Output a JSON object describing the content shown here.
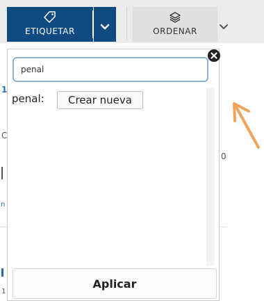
{
  "toolbar": {
    "etiquetar_label": "ETIQUETAR",
    "etiquetar_icon": "tag-icon",
    "dropdown_icon": "chevron-down-icon",
    "ordenar_label": "ORDENAR",
    "ordenar_icon": "layers-icon"
  },
  "popup": {
    "search_value": "penal",
    "clear_icon": "close-icon",
    "result_label": "penal:",
    "create_label": "Crear nueva",
    "apply_label": "Aplicar"
  },
  "background": {
    "glyphs": [
      "1",
      "C",
      "0",
      "n",
      "1"
    ]
  },
  "colors": {
    "primary": "#114a83",
    "arrow": "#f0a35c",
    "input_border": "#8aaee0"
  }
}
